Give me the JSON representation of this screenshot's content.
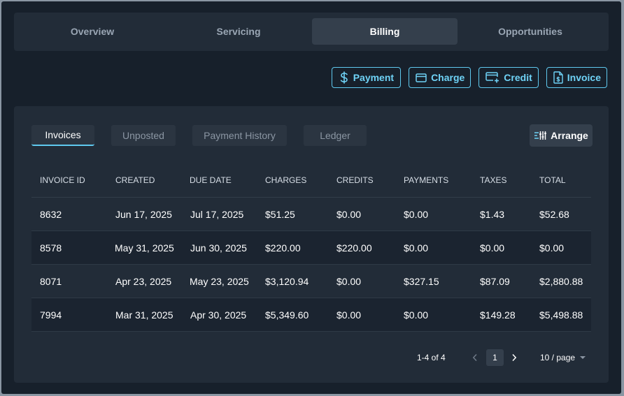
{
  "top_tabs": [
    {
      "label": "Overview"
    },
    {
      "label": "Servicing"
    },
    {
      "label": "Billing"
    },
    {
      "label": "Opportunities"
    }
  ],
  "active_top_tab": "Billing",
  "actions": {
    "payment": {
      "label": "Payment",
      "icon": "dollar-icon"
    },
    "charge": {
      "label": "Charge",
      "icon": "credit-card-icon"
    },
    "credit": {
      "label": "Credit",
      "icon": "card-plus-icon"
    },
    "invoice": {
      "label": "Invoice",
      "icon": "invoice-document-icon"
    }
  },
  "sub_tabs": [
    {
      "label": "Invoices"
    },
    {
      "label": "Unposted"
    },
    {
      "label": "Payment History"
    },
    {
      "label": "Ledger"
    }
  ],
  "active_sub_tab": "Invoices",
  "arrange": {
    "label": "Arrange",
    "icon": "sliders-icon"
  },
  "table": {
    "columns": [
      "INVOICE ID",
      "CREATED",
      "DUE DATE",
      "CHARGES",
      "CREDITS",
      "PAYMENTS",
      "TAXES",
      "TOTAL"
    ],
    "rows": [
      [
        "8632",
        "Jun 17, 2025",
        "Jul 17, 2025",
        "$51.25",
        "$0.00",
        "$0.00",
        "$1.43",
        "$52.68"
      ],
      [
        "8578",
        "May 31, 2025",
        "Jun 30, 2025",
        "$220.00",
        "$220.00",
        "$0.00",
        "$0.00",
        "$0.00"
      ],
      [
        "8071",
        "Apr 23, 2025",
        "May 23, 2025",
        "$3,120.94",
        "$0.00",
        "$327.15",
        "$87.09",
        "$2,880.88"
      ],
      [
        "7994",
        "Mar 31, 2025",
        "Apr 30, 2025",
        "$5,349.60",
        "$0.00",
        "$0.00",
        "$149.28",
        "$5,498.88"
      ]
    ]
  },
  "pagination": {
    "range": "1-4 of 4",
    "current_page": "1",
    "page_size": "10 / page"
  },
  "colors": {
    "accent": "#5fc9ef",
    "background": "#17202b",
    "panel": "#222c38"
  }
}
